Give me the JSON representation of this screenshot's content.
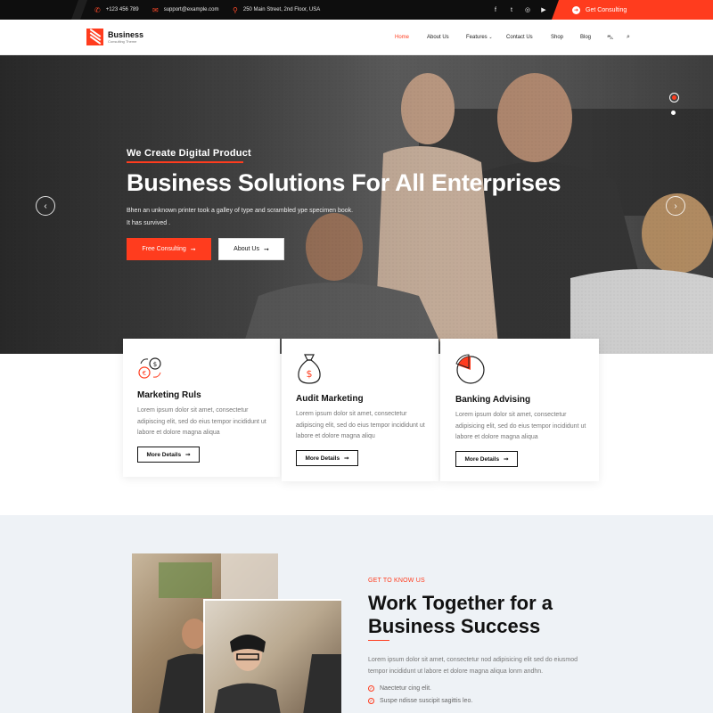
{
  "topbar": {
    "phone": "+123 456 789",
    "email": "support@example.com",
    "address": "250 Main Street, 2nd Floor, USA",
    "social_icons": [
      "facebook-icon",
      "twitter-icon",
      "instagram-icon",
      "youtube-icon"
    ],
    "cta_label": "Get Consulting"
  },
  "header": {
    "logo_name": "Business",
    "logo_tagline": "Consulting Theme",
    "nav": {
      "home": "Home",
      "about": "About Us",
      "features": "Features",
      "contact": "Contact Us",
      "shop": "Shop",
      "blog": "Blog"
    }
  },
  "hero": {
    "kicker": "We Create Digital Product",
    "title": "Business Solutions For All Enterprises",
    "text_line1": "Bhen an unknown printer took a galley of type and scrambled ype specimen book.",
    "text_line2": "It has survived .",
    "primary_button": "Free Consulting",
    "secondary_button": "About Us",
    "arrow_prev": "‹",
    "arrow_next": "›"
  },
  "services": [
    {
      "title": "Marketing Ruls",
      "desc": "Lorem ipsum dolor sit amet, consectetur adipiscing elit, sed do eius tempor incididunt ut labore et dolore magna aliqua",
      "button": "More Details",
      "icon": "money-exchange-icon"
    },
    {
      "title": "Audit Marketing",
      "desc": "Lorem ipsum dolor sit amet, consectetur adipiscing elit, sed do eius tempor incididunt ut labore et dolore magna aliqu",
      "button": "More Details",
      "icon": "money-bag-icon"
    },
    {
      "title": "Banking Advising",
      "desc": "Lorem ipsum dolor sit amet, consectetur adipisicing elit, sed do eius tempor incididunt ut labore et dolore magna aliqua",
      "button": "More Details",
      "icon": "pie-chart-icon"
    }
  ],
  "about": {
    "kicker": "GET TO KNOW US",
    "title": "Work Together for a Business Success",
    "text": "Lorem ipsum dolor sit amet, consectetur nod adipisicing elit sed do eiusmod tempor incididunt ut labore et dolore magna aliqua lonm andhn.",
    "checks": [
      "Naectetur cing elit.",
      "Suspe ndisse suscipit sagittis leo."
    ]
  },
  "colors": {
    "accent": "#ff3c1e",
    "dark": "#0e0e0e",
    "section_bg": "#eef2f6"
  }
}
